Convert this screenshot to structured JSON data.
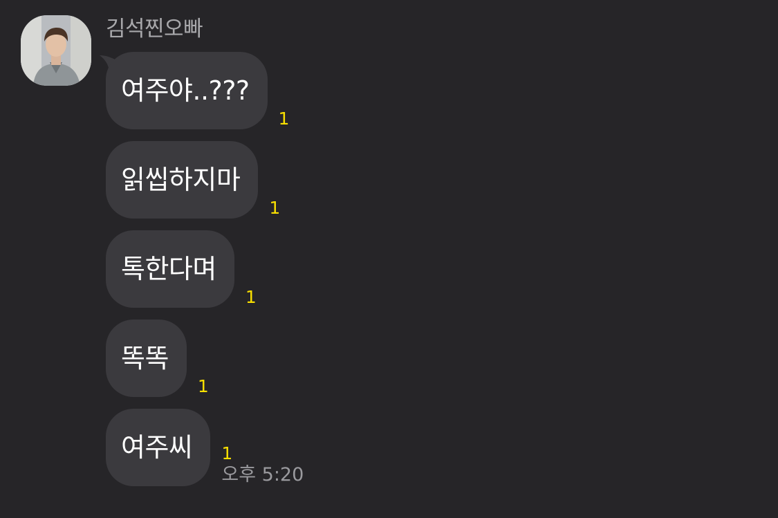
{
  "sender": {
    "name": "김석찐오빠",
    "avatar_icon": "profile-photo-icon"
  },
  "messages": [
    {
      "text": "여주야..???",
      "unread": "1",
      "time": ""
    },
    {
      "text": "읽씹하지마",
      "unread": "1",
      "time": ""
    },
    {
      "text": "톡한다며",
      "unread": "1",
      "time": ""
    },
    {
      "text": "똑똑",
      "unread": "1",
      "time": ""
    },
    {
      "text": "여주씨",
      "unread": "1",
      "time": "오후 5:20"
    }
  ],
  "colors": {
    "background": "#262528",
    "bubble": "#3b3a3e",
    "unread": "#f9e000",
    "sender_name": "#a8a8ab",
    "time": "#9a9a9e"
  }
}
